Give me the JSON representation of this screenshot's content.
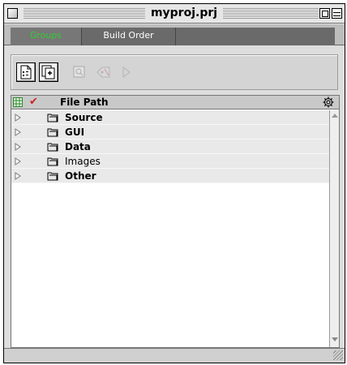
{
  "window": {
    "title": "myproj.prj"
  },
  "tabs": [
    {
      "label": "Groups",
      "active": true
    },
    {
      "label": "Build Order",
      "active": false
    }
  ],
  "toolbar": {
    "buttons": [
      {
        "icon": "new-file-icon",
        "enabled": true
      },
      {
        "icon": "copy-pages-icon",
        "enabled": true
      },
      {
        "icon": "inspect-icon",
        "enabled": false
      },
      {
        "icon": "tag-icon",
        "enabled": false
      },
      {
        "icon": "play-icon",
        "enabled": false
      }
    ]
  },
  "list": {
    "column_header": "File Path",
    "rows": [
      {
        "label": "Source",
        "bold": true
      },
      {
        "label": "GUI",
        "bold": true
      },
      {
        "label": "Data",
        "bold": true
      },
      {
        "label": "Images",
        "bold": false
      },
      {
        "label": "Other",
        "bold": true
      }
    ]
  },
  "colors": {
    "active_tab_text": "#33cc33",
    "check_mark": "#cc2222",
    "row_background": "#e9e9e9"
  }
}
